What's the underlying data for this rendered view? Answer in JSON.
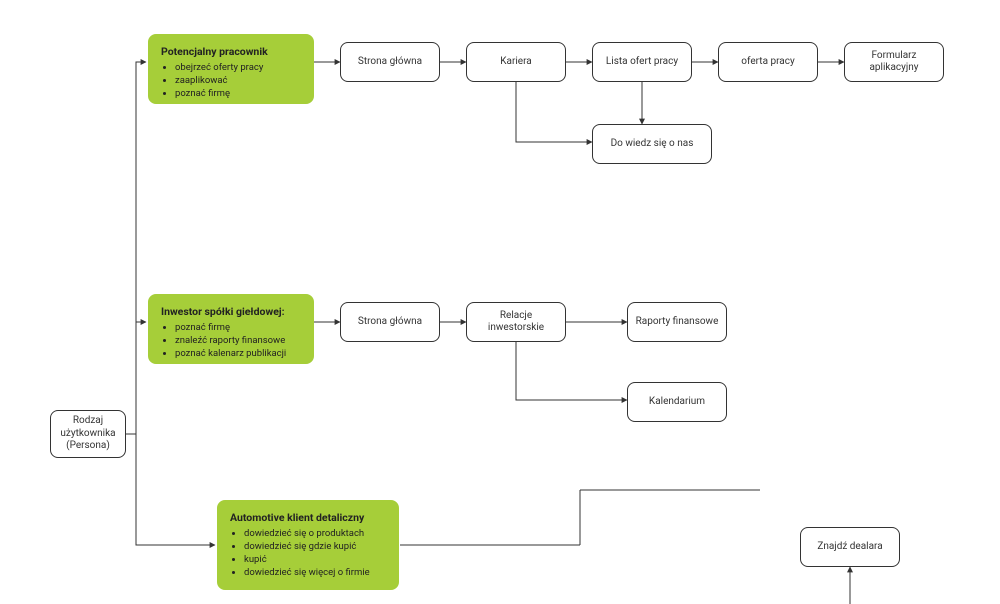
{
  "root": {
    "label": "Rodzaj użytkownika (Persona)"
  },
  "persona1": {
    "title": "Potencjalny pracownik",
    "bullets": [
      "obejrzeć oferty pracy",
      "zaaplikować",
      "poznać firmę"
    ]
  },
  "p1_nodes": {
    "home": "Strona główna",
    "career": "Kariera",
    "jobs": "Lista ofert pracy",
    "offer": "oferta pracy",
    "form": "Formularz aplikacyjny",
    "about": "Do wiedz się o nas"
  },
  "persona2": {
    "title": "Inwestor spółki giełdowej:",
    "bullets": [
      "poznać firmę",
      "znaleźć raporty finansowe",
      "poznać kalenarz publikacji"
    ]
  },
  "p2_nodes": {
    "home": "Strona główna",
    "relations": "Relacje inwestorskie",
    "reports": "Raporty finansowe",
    "calendar": "Kalendarium"
  },
  "persona3": {
    "title": "Automotive klient detaliczny",
    "bullets": [
      "dowiedzieć się o produktach",
      "dowiedzieć się gdzie kupić",
      "kupić",
      "dowiedzieć się więcej o firmie"
    ]
  },
  "p3_nodes": {
    "dealer": "Znajdź dealara"
  }
}
